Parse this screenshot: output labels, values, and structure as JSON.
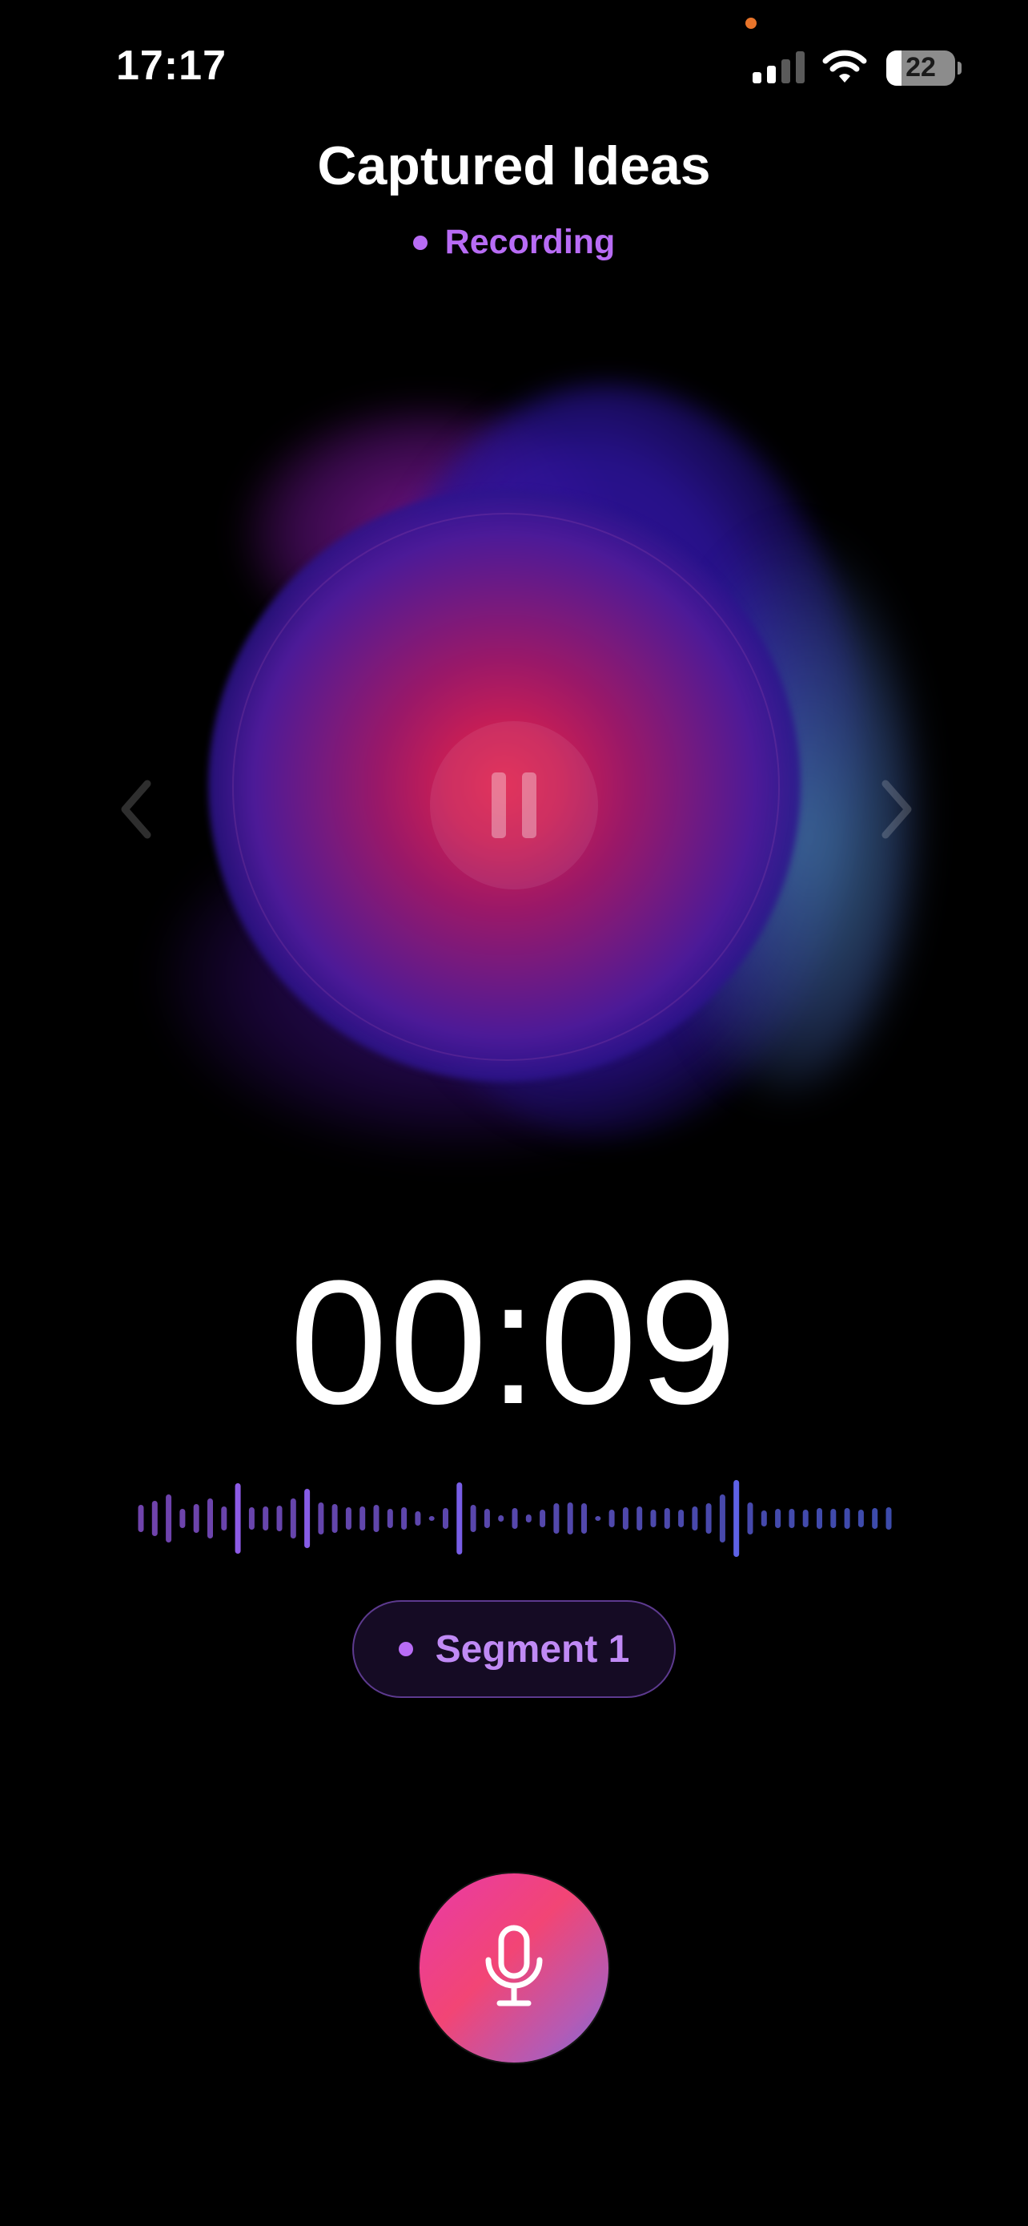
{
  "status_bar": {
    "time": "17:17",
    "battery_level": "22",
    "icons": [
      "signal-icon",
      "wifi-icon",
      "battery-icon"
    ],
    "privacy_dot_color": "#e8742a"
  },
  "header": {
    "title": "Captured Ideas",
    "status_label": "Recording"
  },
  "player": {
    "pause_icon": "pause-icon",
    "prev_icon": "chevron-left-icon",
    "next_icon": "chevron-right-icon"
  },
  "timer": {
    "elapsed": "00:09"
  },
  "segment": {
    "label": "Segment 1"
  },
  "controls": {
    "mic_icon": "microphone-icon"
  },
  "colors": {
    "accent_purple": "#b86cf5",
    "background": "#000000",
    "mic_gradient_start": "#e83aa8",
    "mic_gradient_end": "#7a6ad8"
  }
}
